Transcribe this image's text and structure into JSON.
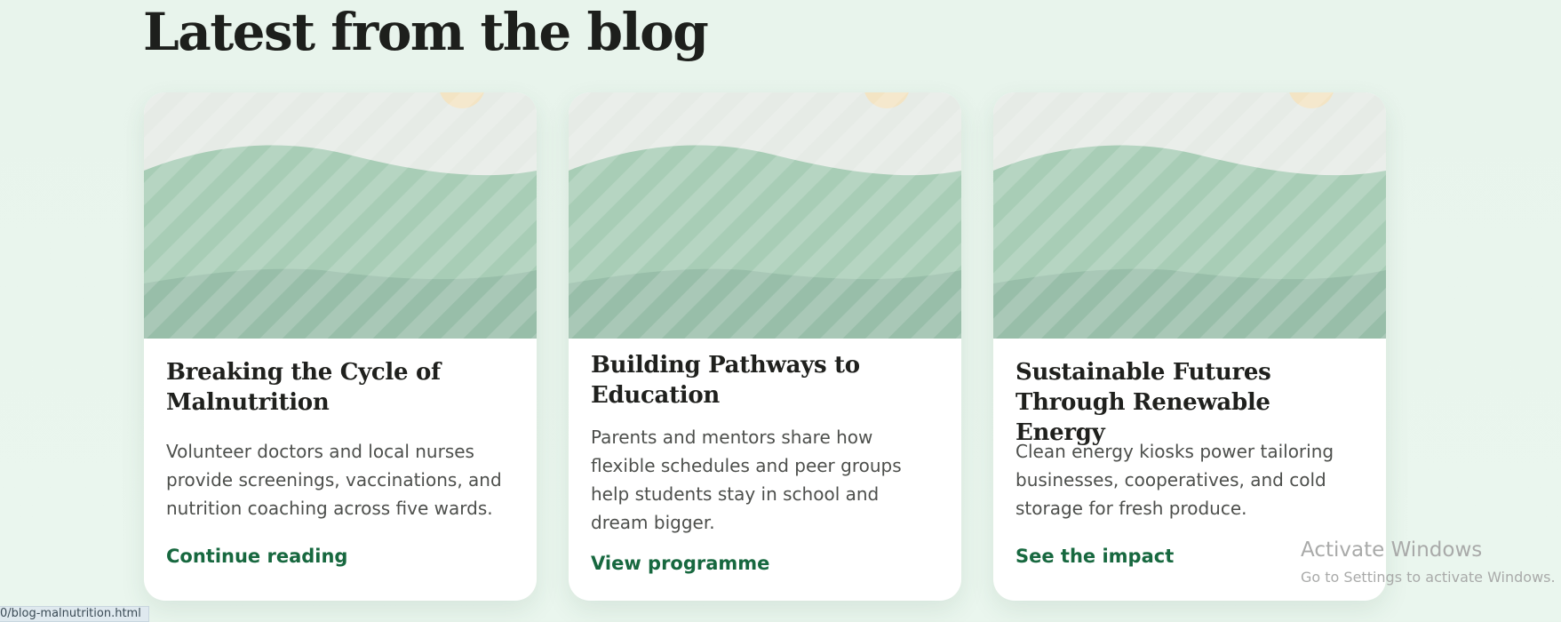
{
  "section": {
    "heading": "Latest from the blog"
  },
  "posts": [
    {
      "title": "Breaking the Cycle of Malnutrition",
      "description": "Volunteer doctors and local nurses provide screenings, vaccinations, and nutrition coaching across five wards.",
      "link_label": "Continue reading"
    },
    {
      "title": "Building Pathways to Education",
      "description": "Parents and mentors share how flexible schedules and peer groups help students stay in school and dream bigger.",
      "link_label": "View programme"
    },
    {
      "title": "Sustainable Futures Through Renewable Energy",
      "description": "Clean energy kiosks power tailoring businesses, cooperatives, and cold storage for fresh produce.",
      "link_label": "See the impact"
    }
  ],
  "watermark": {
    "title": "Activate Windows",
    "subtitle": "Go to Settings to activate Windows."
  },
  "status_bar": {
    "url": "0/blog-malnutrition.html"
  },
  "colors": {
    "background": "#e8f4ec",
    "card": "#ffffff",
    "link": "#17683f",
    "illustration_sky": "#e6ebe6",
    "illustration_hill_front": "#a8cdb6",
    "illustration_hill_back": "#98bea9",
    "illustration_sun": "#f3e4c4"
  }
}
